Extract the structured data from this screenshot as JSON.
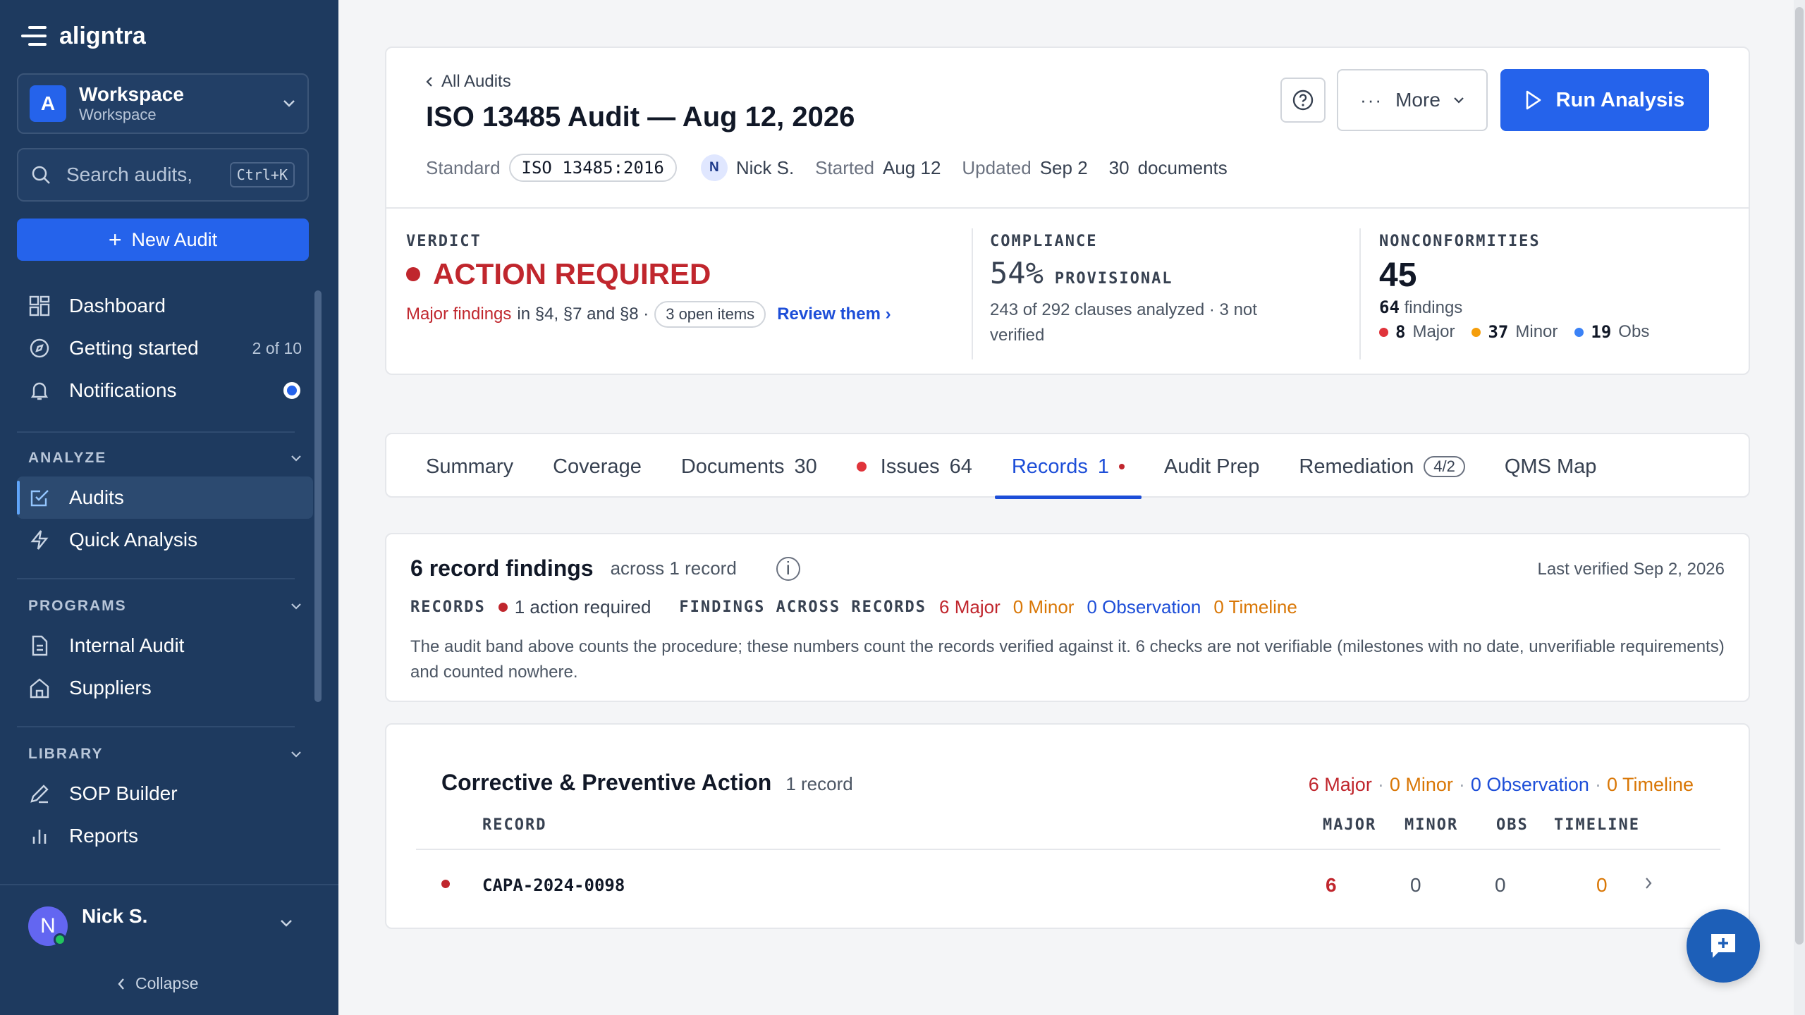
{
  "app": {
    "name": "aligntra"
  },
  "workspace": {
    "avatar": "A",
    "title": "Workspace",
    "subtitle": "Workspace"
  },
  "search": {
    "placeholder": "Search audits,",
    "shortcut": "Ctrl+K"
  },
  "new_audit": {
    "label": "New Audit"
  },
  "nav": {
    "dashboard": "Dashboard",
    "getting_started": "Getting started",
    "getting_started_meta": "2 of 10",
    "notifications": "Notifications"
  },
  "sections": {
    "analyze": {
      "title": "ANALYZE",
      "items": [
        "Audits",
        "Quick Analysis"
      ]
    },
    "programs": {
      "title": "PROGRAMS",
      "items": [
        "Internal Audit",
        "Suppliers"
      ]
    },
    "library": {
      "title": "LIBRARY",
      "items": [
        "SOP Builder",
        "Reports"
      ]
    }
  },
  "user": {
    "initial": "N",
    "name": "Nick S.",
    "collapse": "Collapse"
  },
  "header": {
    "breadcrumb": "All Audits",
    "title": "ISO 13485 Audit — Aug 12, 2026",
    "standard_label": "Standard",
    "standard_value": "ISO 13485:2016",
    "owner_initial": "N",
    "owner": "Nick S.",
    "started_label": "Started",
    "started_value": "Aug 12",
    "updated_label": "Updated",
    "updated_value": "Sep 2",
    "documents_count": "30",
    "documents_label": "documents",
    "more_label": "More",
    "run_label": "Run Analysis"
  },
  "verdict": {
    "label": "VERDICT",
    "value": "ACTION REQUIRED",
    "major_findings": "Major findings",
    "sections_text": "in §4, §7 and §8 ·",
    "open_items": "3 open items",
    "review": "Review them ›"
  },
  "compliance": {
    "label": "COMPLIANCE",
    "value": "54%",
    "tag": "PROVISIONAL",
    "detail": "243 of 292 clauses analyzed · 3 not verified"
  },
  "nonconformities": {
    "label": "NONCONFORMITIES",
    "value": "45",
    "findings_count": "64",
    "findings_label": "findings",
    "major_count": "8",
    "major_label": "Major",
    "minor_count": "37",
    "minor_label": "Minor",
    "obs_count": "19",
    "obs_label": "Obs"
  },
  "tabs": [
    {
      "label": "Summary"
    },
    {
      "label": "Coverage"
    },
    {
      "label": "Documents",
      "count": "30"
    },
    {
      "label": "Issues",
      "count": "64"
    },
    {
      "label": "Records",
      "count": "1"
    },
    {
      "label": "Audit Prep"
    },
    {
      "label": "Remediation",
      "badge": "4/2"
    },
    {
      "label": "QMS Map"
    }
  ],
  "record_findings": {
    "title": "6 record findings",
    "subtitle": "across 1 record",
    "info": "i",
    "last_verified": "Last verified Sep 2, 2026",
    "records_tag": "RECORDS",
    "action": "1 action required",
    "findings_tag": "FINDINGS ACROSS RECORDS",
    "major": "6 Major",
    "minor": "0 Minor",
    "observation": "0 Observation",
    "timeline": "0 Timeline",
    "description": "The audit band above counts the procedure; these numbers count the records verified against it. 6 checks are not verifiable (milestones with no date, unverifiable requirements) and counted nowhere."
  },
  "capa": {
    "title": "Corrective & Preventive Action",
    "subtitle": "1 record",
    "major": "6 Major",
    "minor": "0 Minor",
    "observation": "0 Observation",
    "timeline": "0 Timeline",
    "sep": "·",
    "columns": [
      "RECORD",
      "MAJOR",
      "MINOR",
      "OBS",
      "TIMELINE"
    ],
    "rows": [
      {
        "record": "CAPA-2024-0098",
        "major": "6",
        "minor": "0",
        "obs": "0",
        "timeline": "0"
      }
    ]
  },
  "colors": {
    "sidebar": "#1e3a5f",
    "accent": "#2563eb",
    "major": "#c0262d",
    "minor": "#d97706",
    "observation": "#1d4ed8"
  },
  "icons": {
    "brand": "menu-lines-icon",
    "search": "search-icon",
    "dashboard": "grid-icon",
    "getting_started": "compass-icon",
    "notifications": "bell-icon",
    "audits": "checkbox-edit-icon",
    "quick_analysis": "lightning-icon",
    "internal_audit": "document-icon",
    "suppliers": "building-icon",
    "sop_builder": "pen-icon",
    "reports": "bar-chart-icon",
    "help": "question-circle-icon",
    "run": "play-icon",
    "chat": "chat-plus-icon"
  }
}
